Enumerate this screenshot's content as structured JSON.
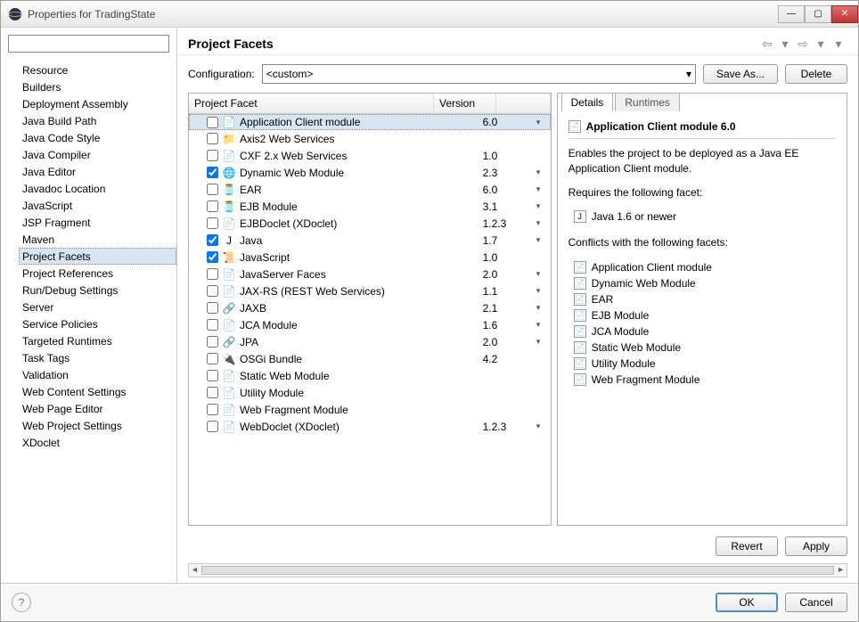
{
  "window": {
    "title": "Properties for TradingState"
  },
  "sidebar": {
    "items": [
      "Resource",
      "Builders",
      "Deployment Assembly",
      "Java Build Path",
      "Java Code Style",
      "Java Compiler",
      "Java Editor",
      "Javadoc Location",
      "JavaScript",
      "JSP Fragment",
      "Maven",
      "Project Facets",
      "Project References",
      "Run/Debug Settings",
      "Server",
      "Service Policies",
      "Targeted Runtimes",
      "Task Tags",
      "Validation",
      "Web Content Settings",
      "Web Page Editor",
      "Web Project Settings",
      "XDoclet"
    ],
    "selected": "Project Facets"
  },
  "header": {
    "title": "Project Facets"
  },
  "config": {
    "label": "Configuration:",
    "value": "<custom>",
    "save_as": "Save As...",
    "delete": "Delete"
  },
  "facets": {
    "columns": {
      "facet": "Project Facet",
      "version": "Version"
    },
    "rows": [
      {
        "checked": false,
        "name": "Application Client module",
        "version": "6.0",
        "drop": true,
        "icon": "doc",
        "selected": true
      },
      {
        "checked": false,
        "name": "Axis2 Web Services",
        "version": "",
        "drop": false,
        "icon": "folder"
      },
      {
        "checked": false,
        "name": "CXF 2.x Web Services",
        "version": "1.0",
        "drop": false,
        "icon": "doc"
      },
      {
        "checked": true,
        "name": "Dynamic Web Module",
        "version": "2.3",
        "drop": true,
        "icon": "globe"
      },
      {
        "checked": false,
        "name": "EAR",
        "version": "6.0",
        "drop": true,
        "icon": "jar"
      },
      {
        "checked": false,
        "name": "EJB Module",
        "version": "3.1",
        "drop": true,
        "icon": "jar"
      },
      {
        "checked": false,
        "name": "EJBDoclet (XDoclet)",
        "version": "1.2.3",
        "drop": true,
        "icon": "doc"
      },
      {
        "checked": true,
        "name": "Java",
        "version": "1.7",
        "drop": true,
        "icon": "java"
      },
      {
        "checked": true,
        "name": "JavaScript",
        "version": "1.0",
        "drop": false,
        "icon": "js"
      },
      {
        "checked": false,
        "name": "JavaServer Faces",
        "version": "2.0",
        "drop": true,
        "icon": "doc"
      },
      {
        "checked": false,
        "name": "JAX-RS (REST Web Services)",
        "version": "1.1",
        "drop": true,
        "icon": "doc"
      },
      {
        "checked": false,
        "name": "JAXB",
        "version": "2.1",
        "drop": true,
        "icon": "bind"
      },
      {
        "checked": false,
        "name": "JCA Module",
        "version": "1.6",
        "drop": true,
        "icon": "doc"
      },
      {
        "checked": false,
        "name": "JPA",
        "version": "2.0",
        "drop": true,
        "icon": "bind"
      },
      {
        "checked": false,
        "name": "OSGi Bundle",
        "version": "4.2",
        "drop": false,
        "icon": "plug"
      },
      {
        "checked": false,
        "name": "Static Web Module",
        "version": "",
        "drop": false,
        "icon": "doc"
      },
      {
        "checked": false,
        "name": "Utility Module",
        "version": "",
        "drop": false,
        "icon": "doc"
      },
      {
        "checked": false,
        "name": "Web Fragment Module",
        "version": "",
        "drop": false,
        "icon": "doc"
      },
      {
        "checked": false,
        "name": "WebDoclet (XDoclet)",
        "version": "1.2.3",
        "drop": true,
        "icon": "doc"
      }
    ]
  },
  "detail": {
    "tabs": [
      "Details",
      "Runtimes"
    ],
    "active_tab": 0,
    "title": "Application Client module 6.0",
    "desc": "Enables the project to be deployed as a Java EE Application Client module.",
    "requires_label": "Requires the following facet:",
    "requires": [
      "Java 1.6 or newer"
    ],
    "conflicts_label": "Conflicts with the following facets:",
    "conflicts": [
      "Application Client module",
      "Dynamic Web Module",
      "EAR",
      "EJB Module",
      "JCA Module",
      "Static Web Module",
      "Utility Module",
      "Web Fragment Module"
    ]
  },
  "actions": {
    "revert": "Revert",
    "apply": "Apply"
  },
  "footer": {
    "ok": "OK",
    "cancel": "Cancel"
  }
}
